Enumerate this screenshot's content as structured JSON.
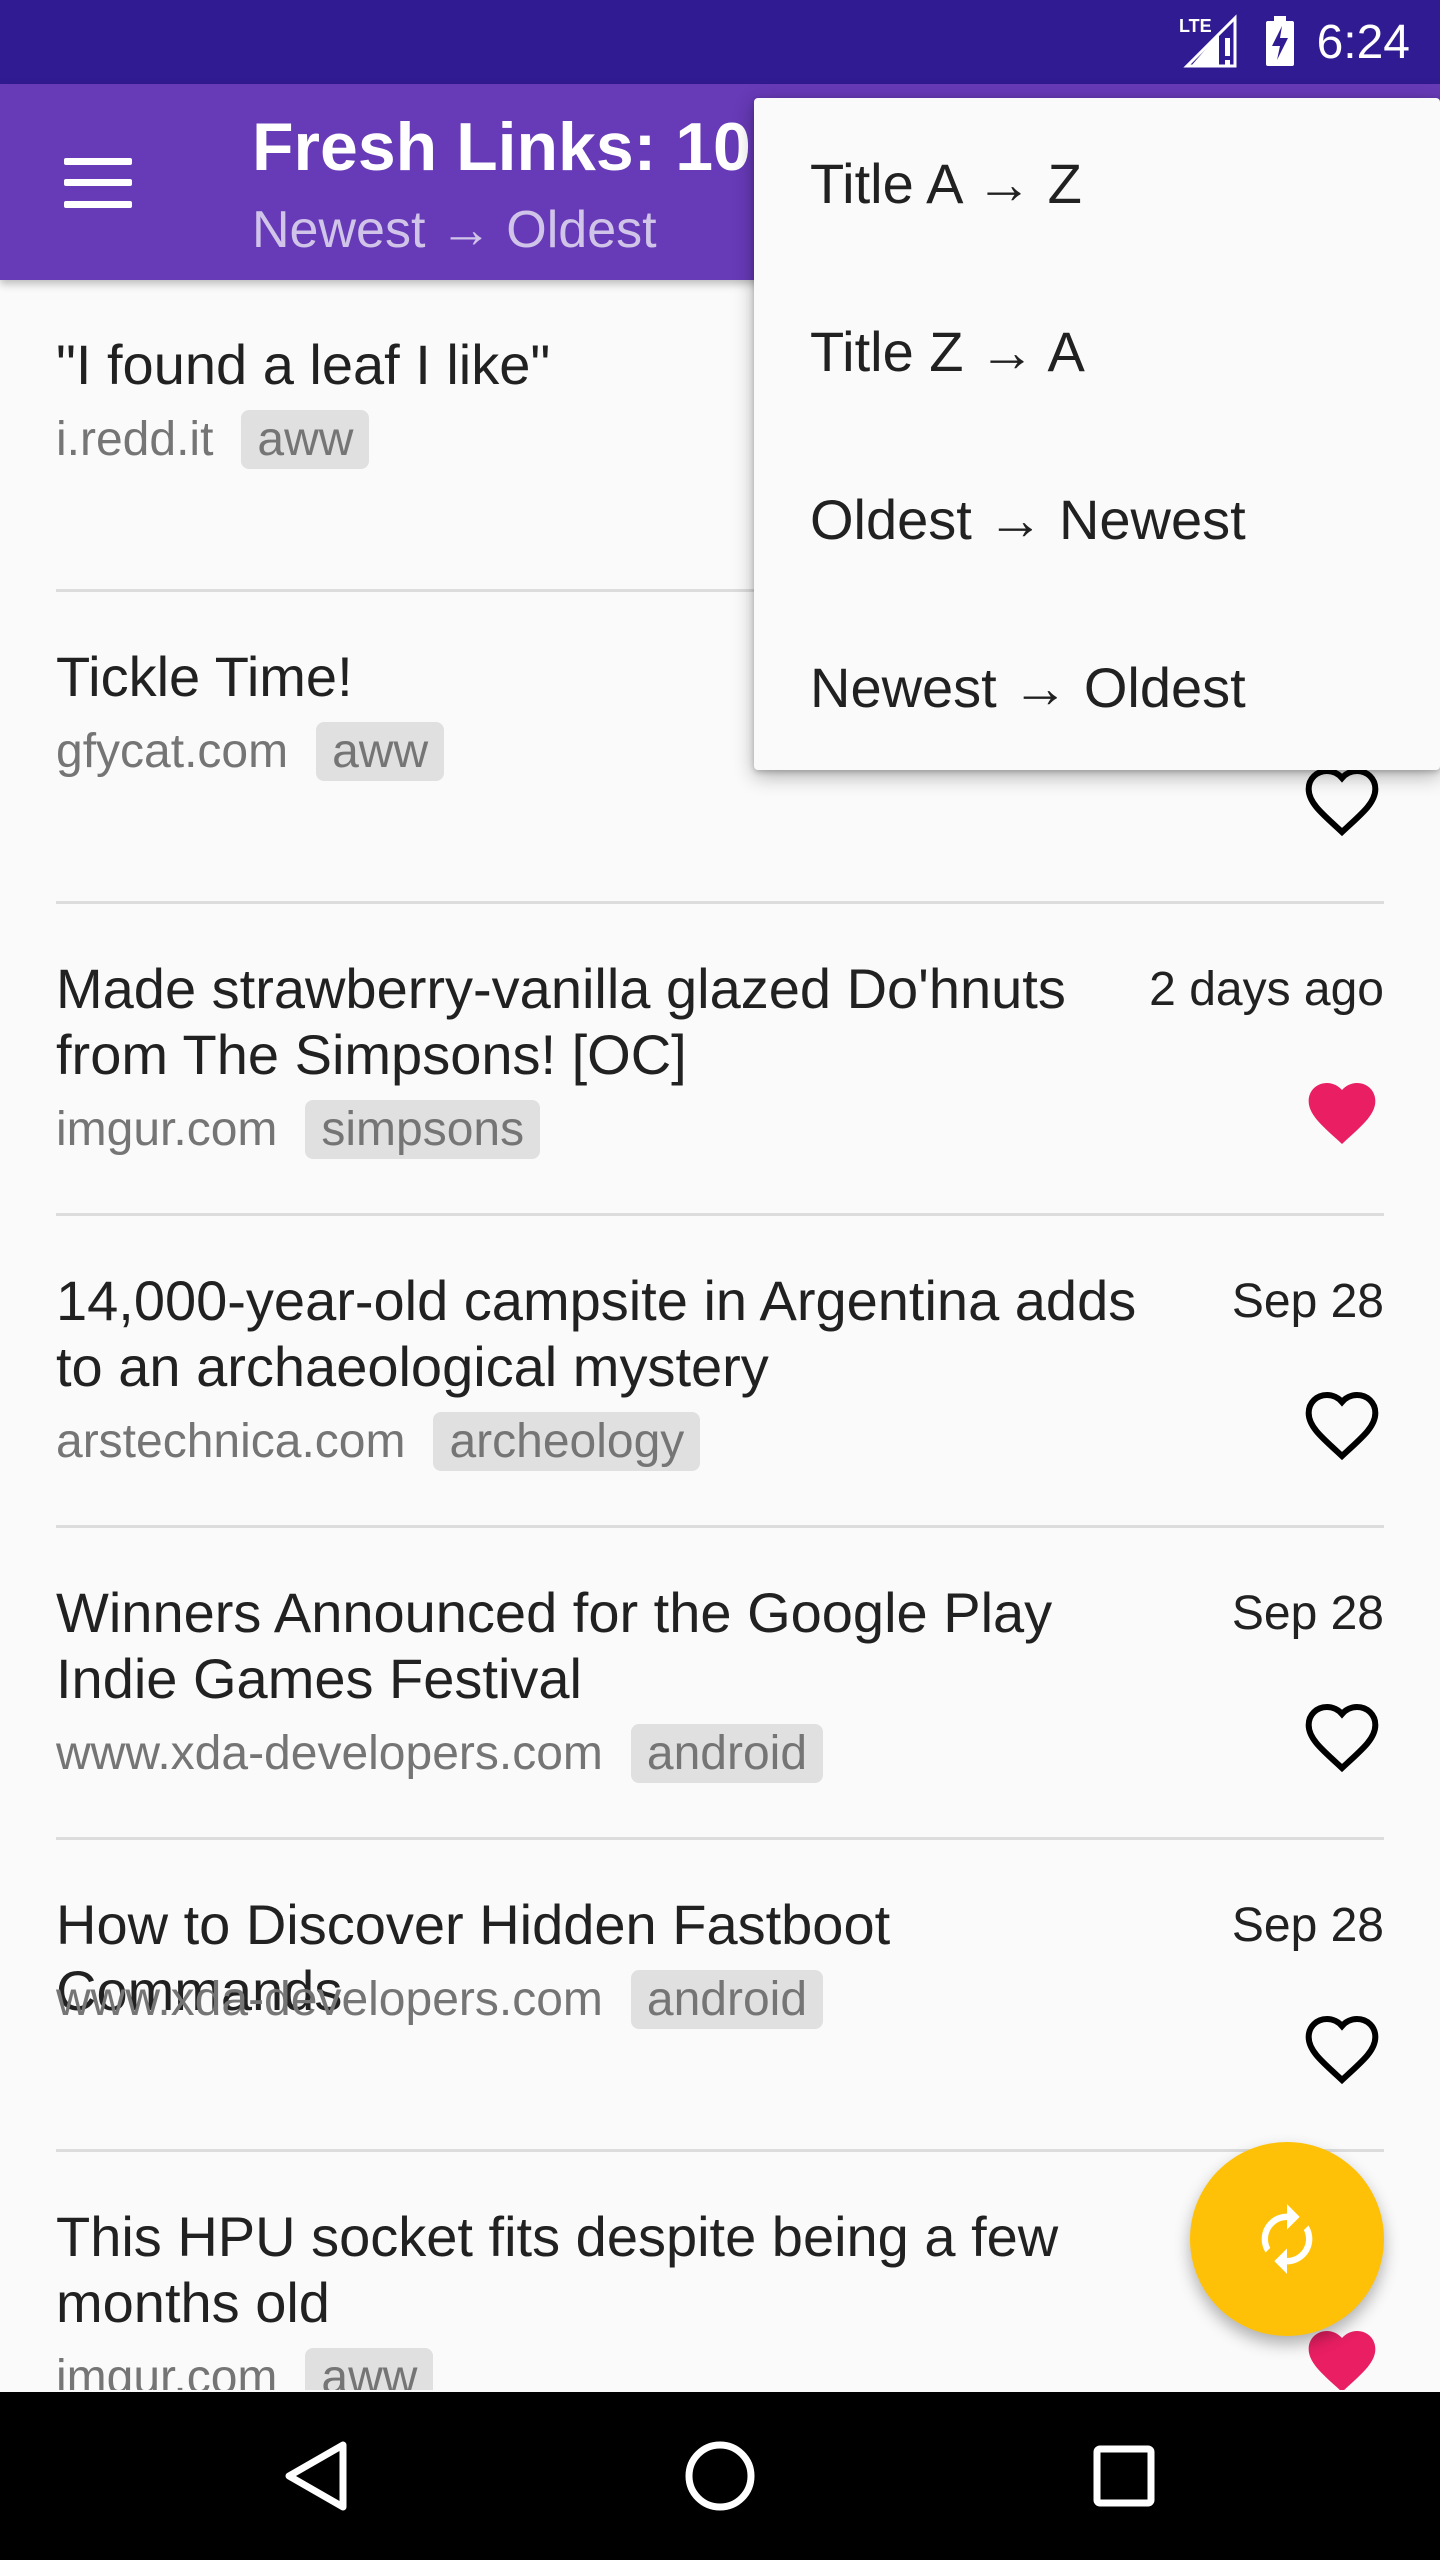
{
  "status_bar": {
    "network": "LTE",
    "time": "6:24"
  },
  "app_bar": {
    "title": "Fresh Links: 10",
    "subtitle": "Newest → Oldest",
    "menu_icon": "hamburger-menu-icon",
    "background": "#673ab7",
    "status_background": "#311b92"
  },
  "sort_menu": {
    "items": [
      {
        "label": "Title A → Z"
      },
      {
        "label": "Title Z → A"
      },
      {
        "label": "Oldest → Newest"
      },
      {
        "label": "Newest → Oldest"
      }
    ]
  },
  "links": [
    {
      "title": "\"I found a leaf I like\"",
      "domain": "i.redd.it",
      "tag": "aww",
      "date": "",
      "favorited": false
    },
    {
      "title": "Tickle Time!",
      "domain": "gfycat.com",
      "tag": "aww",
      "date": "",
      "favorited": false
    },
    {
      "title": "Made strawberry-vanilla glazed Do'hnuts from The Simpsons! [OC]",
      "domain": "imgur.com",
      "tag": "simpsons",
      "date": "2 days ago",
      "favorited": true
    },
    {
      "title": "14,000-year-old campsite in Argentina adds to an archaeological mystery",
      "domain": "arstechnica.com",
      "tag": "archeology",
      "date": "Sep 28",
      "favorited": false
    },
    {
      "title": "Winners Announced for the Google Play Indie Games Festival",
      "domain": "www.xda-developers.com",
      "tag": "android",
      "date": "Sep 28",
      "favorited": false
    },
    {
      "title": "How to Discover Hidden Fastboot Commands",
      "domain": "www.xda-developers.com",
      "tag": "android",
      "date": "Sep 28",
      "favorited": false
    },
    {
      "title": "This HPU socket fits despite being a few months old",
      "domain": "imgur.com",
      "tag": "aww",
      "date": "",
      "favorited": true
    }
  ],
  "colors": {
    "accent": "#ffc107",
    "favorite": "#e91e63"
  },
  "fab": {
    "icon": "refresh-icon"
  },
  "nav_bar": {
    "back_icon": "back-triangle-icon",
    "home_icon": "home-circle-icon",
    "recents_icon": "recents-square-icon"
  }
}
